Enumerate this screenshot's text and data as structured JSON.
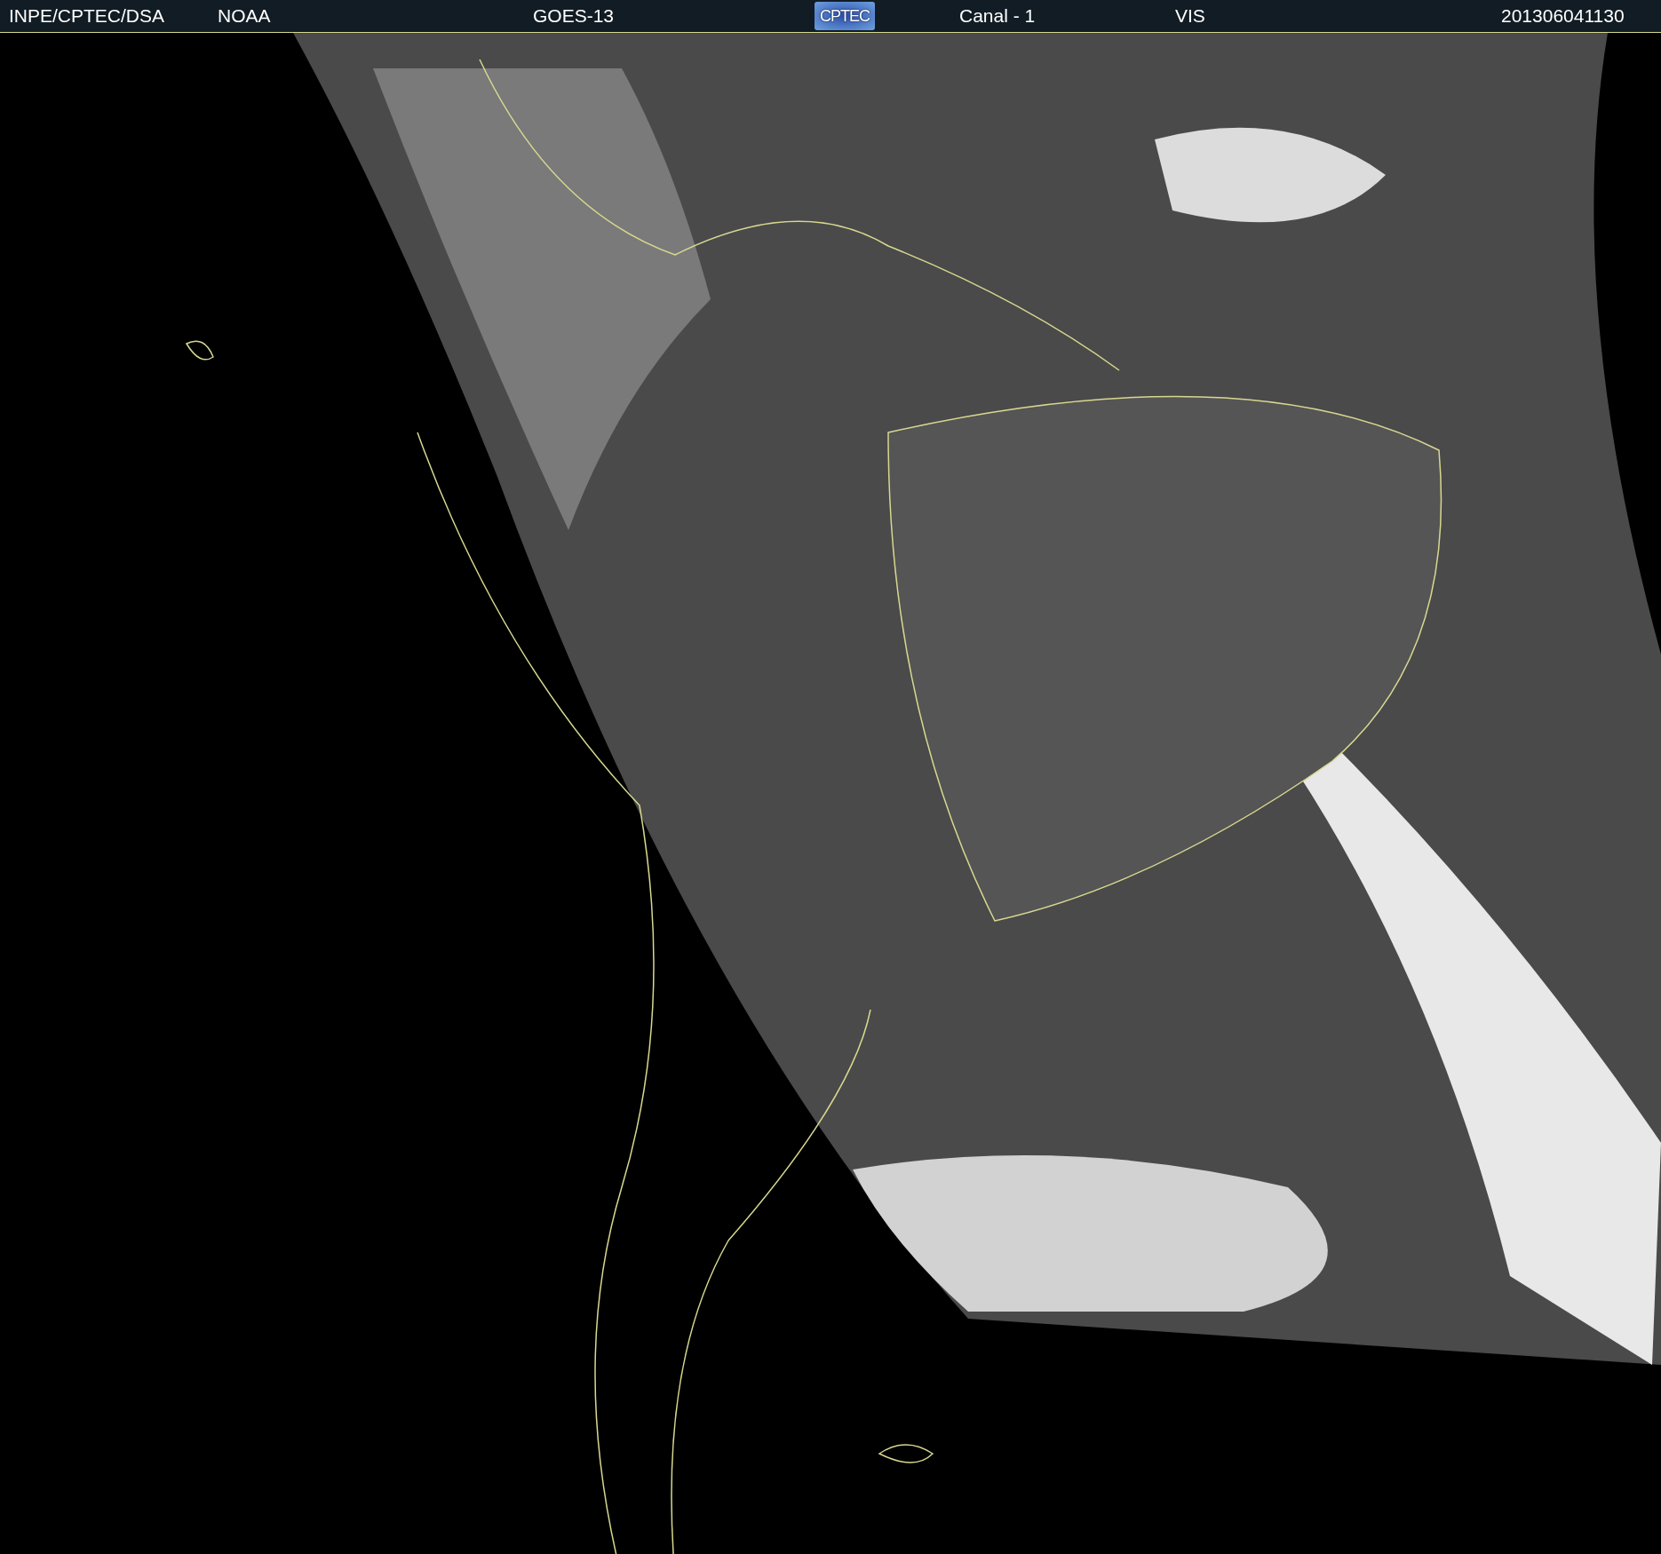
{
  "header": {
    "items": [
      {
        "kind": "text",
        "text": "INPE/CPTEC/DSA"
      },
      {
        "kind": "text",
        "text": "NOAA"
      },
      {
        "kind": "text",
        "text": "GOES-13"
      },
      {
        "kind": "logo",
        "text": "CPTEC"
      },
      {
        "kind": "text",
        "text": "Canal - 1"
      },
      {
        "kind": "text",
        "text": "VIS"
      },
      {
        "kind": "text",
        "text": "201306041130"
      }
    ]
  }
}
